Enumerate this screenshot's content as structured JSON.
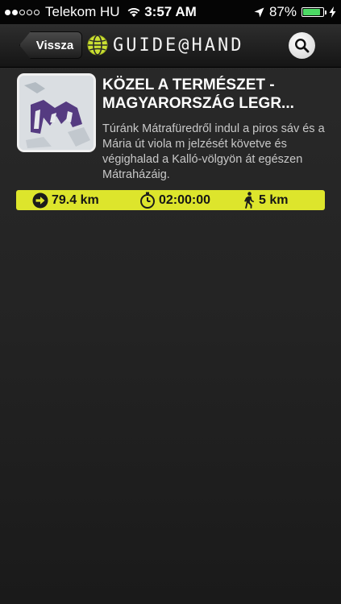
{
  "status_bar": {
    "carrier": "Telekom HU",
    "time": "3:57 AM",
    "battery_percent": "87%",
    "battery_level": 0.87,
    "signal_bars_filled": 2,
    "signal_bars_total": 5,
    "icons": [
      "wifi-icon",
      "location-arrow-icon",
      "battery-icon",
      "charging-bolt-icon"
    ]
  },
  "nav": {
    "back_label": "Vissza",
    "logo_text": "GUIDE@HAND",
    "icons": [
      "globe-icon",
      "search-icon"
    ]
  },
  "tour": {
    "title_line1": "KÖZEL A TERMÉSZET -",
    "title_line2": "MAGYARORSZÁG LEGR...",
    "description": "Túránk Mátrafüredről indul a piros sáv és a Mária út viola m jelzését követve és végighalad a Kalló-völgyön át egészen Mátraházáig.",
    "stats": {
      "distance": "79.4 km",
      "duration": "02:00:00",
      "walk": "5 km"
    },
    "icons": [
      "arrow-right-circle-icon",
      "stopwatch-icon",
      "walking-person-icon"
    ]
  },
  "colors": {
    "accent": "#dde52c",
    "battery": "#4cd964",
    "background": "#232323"
  }
}
